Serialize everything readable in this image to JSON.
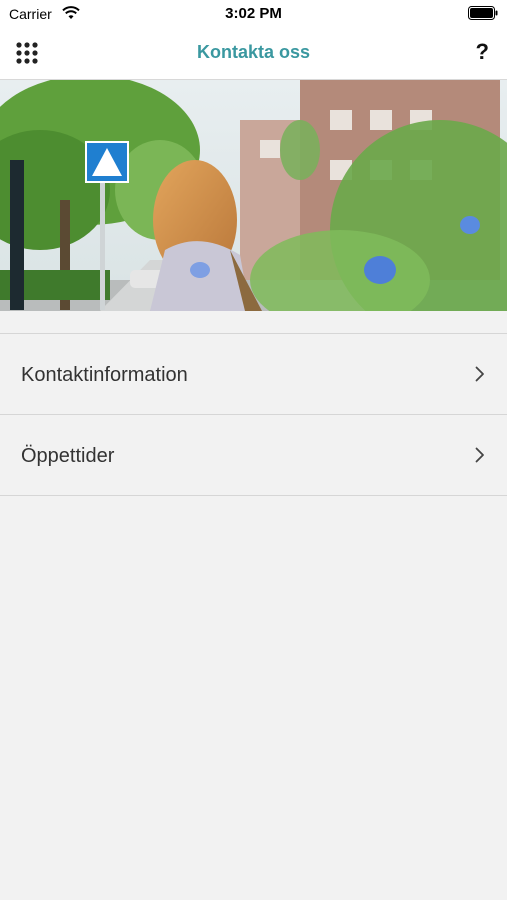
{
  "status_bar": {
    "carrier": "Carrier",
    "time": "3:02 PM",
    "icons": [
      "wifi-icon",
      "battery-icon"
    ]
  },
  "nav": {
    "title": "Kontakta oss",
    "left_icon": "grid-menu-icon",
    "right_icon": "help-icon",
    "help_label": "?"
  },
  "colors": {
    "accent": "#3a98a0",
    "background": "#f2f2f2",
    "divider": "#d6d6d6"
  },
  "list": {
    "items": [
      {
        "label": "Kontaktinformation",
        "icon": "chevron-right-icon"
      },
      {
        "label": "Öppettider",
        "icon": "chevron-right-icon"
      }
    ]
  }
}
